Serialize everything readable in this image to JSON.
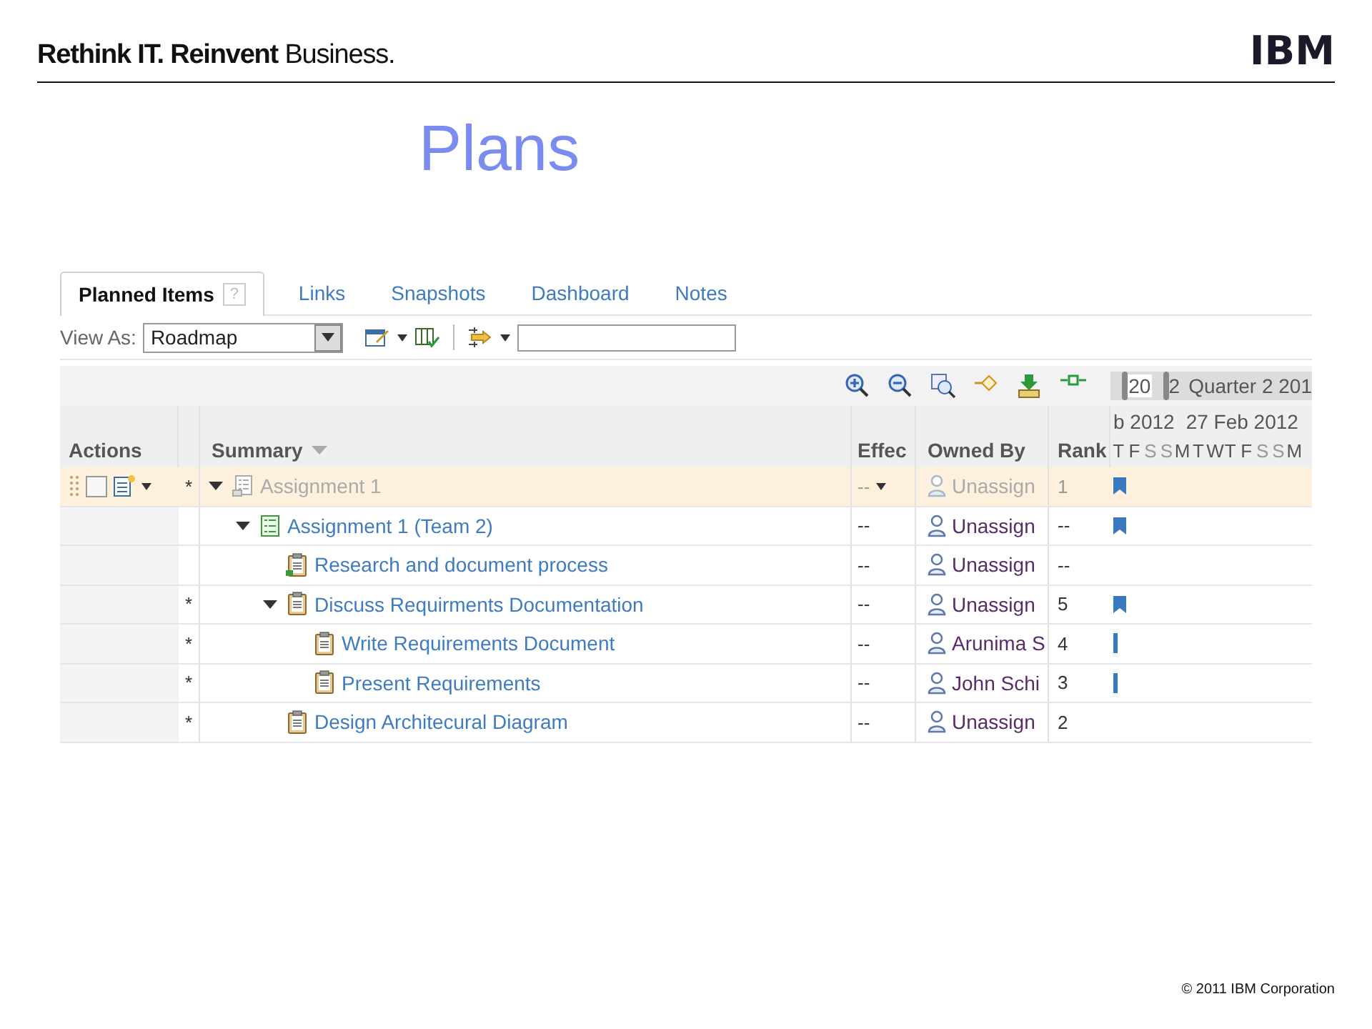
{
  "header": {
    "tagline_bold": "Rethink IT. Reinvent",
    "tagline_rest": "Business.",
    "logo": "IBM"
  },
  "title": "Plans",
  "tabs": [
    {
      "label": "Planned Items",
      "selected": true
    },
    {
      "label": "Links",
      "selected": false
    },
    {
      "label": "Snapshots",
      "selected": false
    },
    {
      "label": "Dashboard",
      "selected": false
    },
    {
      "label": "Notes",
      "selected": false
    }
  ],
  "help_badge": "?",
  "toolbar": {
    "view_label": "View As:",
    "view_value": "Roadmap"
  },
  "timeline": {
    "range_start": "20",
    "range_end": "2",
    "quarter": "Quarter 2 201",
    "weeks": [
      "b 2012",
      "27 Feb 2012"
    ],
    "days": [
      {
        "d": "T",
        "weekend": false
      },
      {
        "d": "F",
        "weekend": false
      },
      {
        "d": "S",
        "weekend": true
      },
      {
        "d": "S",
        "weekend": true
      },
      {
        "d": "M",
        "weekend": false
      },
      {
        "d": "T",
        "weekend": false
      },
      {
        "d": "W",
        "weekend": false
      },
      {
        "d": "T",
        "weekend": false
      },
      {
        "d": "F",
        "weekend": false
      },
      {
        "d": "S",
        "weekend": true
      },
      {
        "d": "S",
        "weekend": true
      },
      {
        "d": "M",
        "weekend": false
      }
    ]
  },
  "columns": {
    "actions": "Actions",
    "summary": "Summary",
    "effort": "Effec",
    "owner": "Owned By",
    "rank": "Rank"
  },
  "rows": [
    {
      "summary": "Assignment 1",
      "kind": "plan",
      "selected": true,
      "change_mark": "*",
      "expanded": true,
      "effort": "--",
      "owner": "Unassign",
      "rank": "1",
      "flag_marker": true,
      "bar_marker": false,
      "children": [
        {
          "summary": "Assignment 1 (Team 2)",
          "kind": "team_plan",
          "selected": false,
          "expanded": true,
          "effort": "--",
          "owner": "Unassign",
          "rank": "--",
          "flag_marker": true,
          "bar_marker": false,
          "children": [
            {
              "summary": "Research and document process",
              "kind": "linked_task",
              "selected": false,
              "effort": "--",
              "owner": "Unassign",
              "rank": "--",
              "flag_marker": false,
              "bar_marker": false
            },
            {
              "summary": "Discuss Requirments Documentation",
              "kind": "task",
              "selected": false,
              "change_mark": "*",
              "expanded": true,
              "effort": "--",
              "owner": "Unassign",
              "rank": "5",
              "flag_marker": true,
              "bar_marker": false,
              "children": [
                {
                  "summary": "Write Requirements Document",
                  "kind": "task",
                  "selected": false,
                  "change_mark": "*",
                  "effort": "--",
                  "owner": "Arunima S",
                  "rank": "4",
                  "flag_marker": false,
                  "bar_marker": true
                },
                {
                  "summary": "Present Requirements",
                  "kind": "task",
                  "selected": false,
                  "change_mark": "*",
                  "effort": "--",
                  "owner": "John Schi",
                  "rank": "3",
                  "flag_marker": false,
                  "bar_marker": true
                }
              ]
            },
            {
              "summary": "Design Architecural Diagram",
              "kind": "task",
              "selected": false,
              "change_mark": "*",
              "effort": "--",
              "owner": "Unassign",
              "rank": "2",
              "flag_marker": false,
              "bar_marker": false
            }
          ]
        }
      ]
    }
  ],
  "footer": "© 2011 IBM Corporation"
}
